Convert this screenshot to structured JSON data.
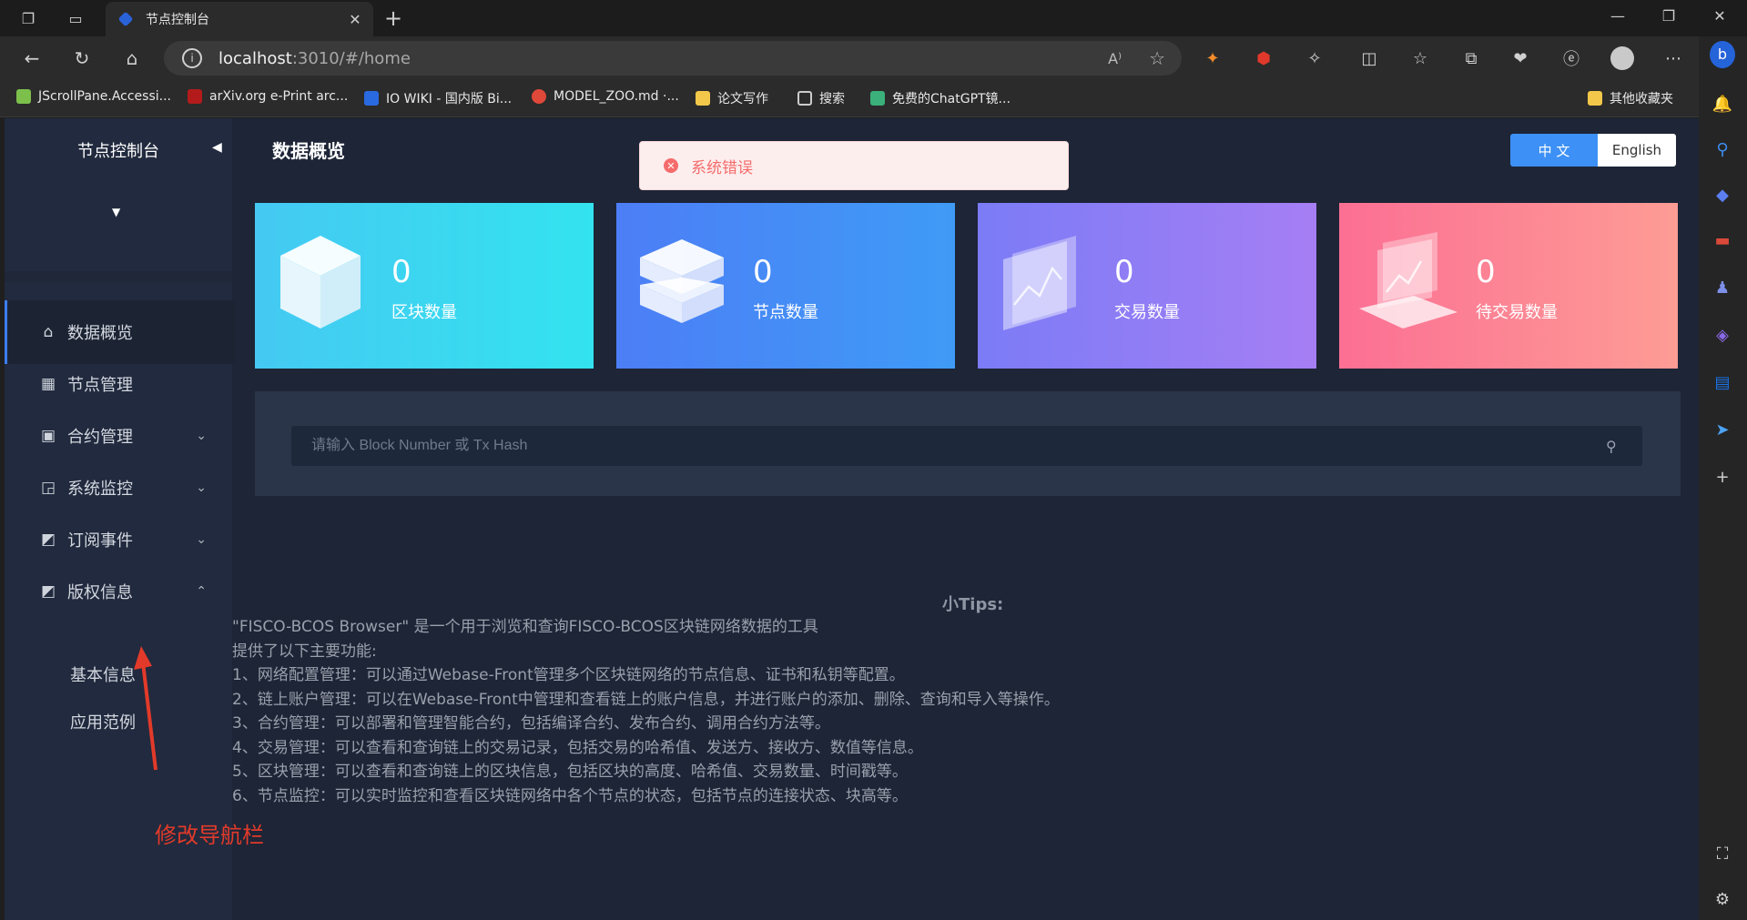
{
  "browser": {
    "tab_title": "节点控制台",
    "url_host": "localhost",
    "url_rest": ":3010/#/home",
    "read_aloud": "A⁾",
    "bookmarks": [
      {
        "label": "JScrollPane.Accessi...",
        "color": "#7cc04b"
      },
      {
        "label": "arXiv.org e-Print arc...",
        "color": "#b31b1b"
      },
      {
        "label": "IO WIKI - 国内版 Bi...",
        "color": "#2a6ae0"
      },
      {
        "label": "MODEL_ZOO.md ·...",
        "color": "#e0483a"
      },
      {
        "label": "论文写作",
        "color": "#f3c84a"
      },
      {
        "label": "搜索",
        "color": "#cccccc"
      },
      {
        "label": "免费的ChatGPT镜...",
        "color": "#3bb07a"
      }
    ],
    "other_bookmarks": "其他收藏夹"
  },
  "sidebar": {
    "title": "节点控制台",
    "items": [
      {
        "label": "数据概览",
        "icon": "home-icon",
        "glyph": "⌂",
        "expand": ""
      },
      {
        "label": "节点管理",
        "icon": "calendar-icon",
        "glyph": "▦",
        "expand": ""
      },
      {
        "label": "合约管理",
        "icon": "clipboard-icon",
        "glyph": "▣",
        "expand": "⌄"
      },
      {
        "label": "系统监控",
        "icon": "monitor-icon",
        "glyph": "◲",
        "expand": "⌄"
      },
      {
        "label": "订阅事件",
        "icon": "rss-icon",
        "glyph": "◩",
        "expand": "⌄"
      },
      {
        "label": "版权信息",
        "icon": "rss-icon",
        "glyph": "◩",
        "expand": "⌃"
      }
    ],
    "sub_items": [
      "基本信息",
      "应用范例"
    ]
  },
  "annotation": {
    "text": "修改导航栏",
    "color": "#e23a2a"
  },
  "main": {
    "title": "数据概览",
    "alert": "系统错误",
    "lang_cn": "中 文",
    "lang_en": "English",
    "cards": [
      {
        "value": "0",
        "label": "区块数量",
        "from": "#45c9f2",
        "to": "#33e3ef"
      },
      {
        "value": "0",
        "label": "节点数量",
        "from": "#4c7ef6",
        "to": "#3f9bf6"
      },
      {
        "value": "0",
        "label": "交易数量",
        "from": "#7b7cf6",
        "to": "#a67ef4"
      },
      {
        "value": "0",
        "label": "待交易数量",
        "from": "#fc6f94",
        "to": "#fd9c95"
      }
    ],
    "search_placeholder": "请输入 Block Number 或 Tx Hash",
    "tips_title": "小Tips:",
    "tips": [
      "\"FISCO-BCOS Browser\" 是一个用于浏览和查询FISCO-BCOS区块链网络数据的工具",
      "提供了以下主要功能:",
      "1、网络配置管理：可以通过Webase-Front管理多个区块链网络的节点信息、证书和私钥等配置。",
      "2、链上账户管理：可以在Webase-Front中管理和查看链上的账户信息，并进行账户的添加、删除、查询和导入等操作。",
      "3、合约管理：可以部署和管理智能合约，包括编译合约、发布合约、调用合约方法等。",
      "4、交易管理：可以查看和查询链上的交易记录，包括交易的哈希值、发送方、接收方、数值等信息。",
      "5、区块管理：可以查看和查询链上的区块信息，包括区块的高度、哈希值、交易数量、时间戳等。",
      "6、节点监控：可以实时监控和查看区块链网络中各个节点的状态，包括节点的连接状态、块高等。"
    ]
  }
}
